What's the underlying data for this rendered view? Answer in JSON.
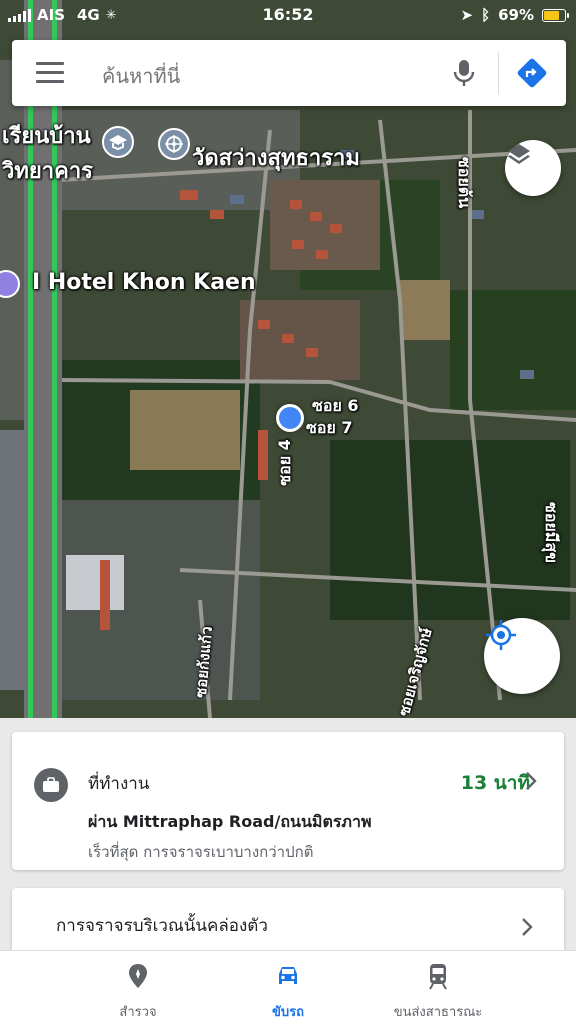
{
  "status_bar": {
    "carrier": "AIS",
    "network": "4G",
    "time": "16:52",
    "battery": "69%",
    "battery_level": 0.69
  },
  "search": {
    "placeholder": "ค้นหาที่นี่"
  },
  "map": {
    "labels": {
      "school_line1": "เรียนบ้าน",
      "school_line2": "วิทยาคาร",
      "temple": "วัดสว่างสุทธาราม",
      "hotel": "I Hotel Khon Kaen",
      "soi6": "ซอย 6",
      "soi7": "ซอย 7",
      "soi4": "ซอย 4",
      "soi_ton": "ซอยต้น",
      "soi_mi": "ซอยมีสุข",
      "soi_kang": "ซอยกังแก้ว",
      "soi_jaroen": "ซอยเจริญจักษ์"
    }
  },
  "commute": {
    "title": "ที่ทำงาน",
    "eta": "13 นาที",
    "via": "ผ่าน Mittraphap Road/ถนนมิตรภาพ",
    "note": "เร็วที่สุด การจราจรเบาบางกว่าปกติ"
  },
  "traffic": {
    "title": "การจราจรบริเวณนั้นคล่องตัว"
  },
  "nav": {
    "explore": "สำรวจ",
    "driving": "ขับรถ",
    "transit": "ขนส่งสาธารณะ"
  },
  "colors": {
    "accent": "#1a73e8",
    "eta_green": "#188038",
    "location_blue": "#4285f4",
    "road_green": "#34c759"
  }
}
